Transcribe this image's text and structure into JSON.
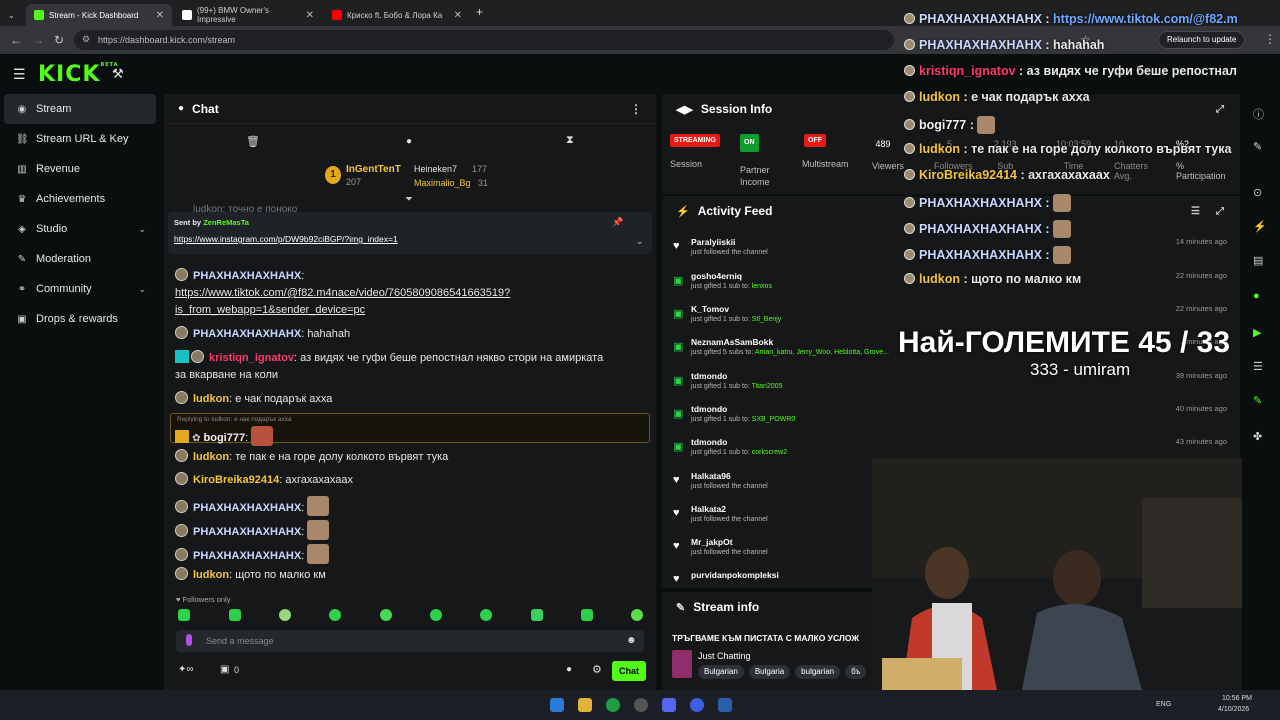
{
  "browser": {
    "tabs": [
      {
        "title": "Stream - Kick Dashboard",
        "active": true
      },
      {
        "title": "(99+) BMW Owner's Impressive",
        "active": false
      },
      {
        "title": "Криско ft. Бобо & Лора Ка",
        "active": false
      }
    ],
    "new_tab": "+",
    "url": "https://dashboard.kick.com/stream",
    "relaunch_label": "Relaunch to update"
  },
  "kick": {
    "logo": "KICK",
    "logo_beta": "BETA"
  },
  "sidebar": {
    "items": [
      {
        "label": "Stream",
        "icon": "stream-icon"
      },
      {
        "label": "Stream URL & Key",
        "icon": "link-icon"
      },
      {
        "label": "Revenue",
        "icon": "revenue-icon"
      },
      {
        "label": "Achievements",
        "icon": "trophy-icon"
      },
      {
        "label": "Studio",
        "icon": "studio-icon"
      },
      {
        "label": "Moderation",
        "icon": "wrench-icon"
      },
      {
        "label": "Community",
        "icon": "community-icon"
      },
      {
        "label": "Drops & rewards",
        "icon": "gift-icon"
      }
    ]
  },
  "chat": {
    "title": "Chat",
    "leaderboard": {
      "rank": "1",
      "first_name": "InGentTenT",
      "first_count": "207",
      "second_name": "Heineken7",
      "second_count": "177",
      "third_name": "Maximalio_Bg",
      "third_count": "31"
    },
    "behind_text": "ludkon: точно е поноко",
    "pinned": {
      "sent_by_label": "Sent by",
      "sender": "ZenReMasTa",
      "link": "https://www.instagram.com/p/DW9b92ciBGP/?img_index=1"
    },
    "messages": [
      {
        "user": "РНАХНАХНАХНАНХ",
        "text": "",
        "link": "https://www.tiktok.com/@f82.m4nace/video/7605809086541663519?",
        "link2": "is_from_webapp=1&sender_device=pc",
        "color": "#c9d8ff"
      },
      {
        "user": "РНАХНАХНАХНАНХ",
        "text": "hahahah",
        "color": "#c9d8ff"
      },
      {
        "user": "kristiqn_ignatov",
        "text": "аз видях че гуфи беше репостнал някво стори на амирката",
        "text2": "за вкарване на коли",
        "color": "#ff3b6b"
      },
      {
        "user": "ludkon",
        "text": "е чак подарък ахха",
        "color": "#f5c542"
      },
      {
        "reply": "Replying to ludkon: е чак подарък ахха",
        "user": "bogi777",
        "text": "",
        "color": "#f0f0f0"
      },
      {
        "user": "ludkon",
        "text": "те пак е на горе долу колкото вървят тука",
        "color": "#f5c542"
      },
      {
        "user": "KiroBreika92414",
        "text": "ахгахахахаах",
        "color": "#f5c542"
      },
      {
        "user": "РНАХНАХНАХНАНХ",
        "text": "",
        "color": "#c9d8ff"
      },
      {
        "user": "РНАХНАХНАХНАНХ",
        "text": "",
        "color": "#c9d8ff"
      },
      {
        "user": "РНАХНАХНАХНАНХ",
        "text": "",
        "color": "#c9d8ff"
      },
      {
        "user": "ludkon",
        "text": "щото по малко км",
        "color": "#f5c542"
      }
    ],
    "followers_only": "Followers only",
    "input_placeholder": "Send a message",
    "footer_count": "0",
    "send_label": "Chat"
  },
  "session": {
    "title": "Session Info",
    "stats": [
      {
        "value": "STREAMING",
        "label": "Session",
        "badge_color": "#e91916"
      },
      {
        "value": "ON",
        "label": "Partner Income",
        "badge_color": "#0f9d2e"
      },
      {
        "value": "OFF",
        "label": "Multistream",
        "badge_color": "#e91916"
      },
      {
        "value": "489",
        "label": "Viewers"
      },
      {
        "value": "5...",
        "label": "Followers"
      },
      {
        "value": "2,193",
        "label": "Sub"
      },
      {
        "value": "10:03:59",
        "label": "Time"
      },
      {
        "value": "10",
        "label": "Chatters Avg."
      },
      {
        "value": "%2",
        "label": "% Participation"
      }
    ]
  },
  "activity": {
    "title": "Activity Feed",
    "items": [
      {
        "name": "Paralyiiskii",
        "desc": "just followed the channel",
        "time": "14 minutes ago",
        "type": "follow"
      },
      {
        "name": "gosho4erniq",
        "desc": "just gifted 1 sub to:",
        "gift": "lenxos",
        "time": "22 minutes ago",
        "type": "gift"
      },
      {
        "name": "K_Tomov",
        "desc": "just gifted 1 sub to:",
        "gift": "Stl_Benjy",
        "time": "22 minutes ago",
        "type": "gift"
      },
      {
        "name": "NeznamAsSamBokk",
        "desc": "just gifted 5 subs to:",
        "gift": "Aman_katru, Jerry_Woo, Heblotta, Grove...",
        "time": "...minutes ago",
        "type": "gift"
      },
      {
        "name": "tdmondo",
        "desc": "just gifted 1 sub to:",
        "gift": "Titan2005",
        "time": "39 minutes ago",
        "type": "gift"
      },
      {
        "name": "tdmondo",
        "desc": "just gifted 1 sub to:",
        "gift": "SXB_POWR0",
        "time": "40 minutes ago",
        "type": "gift"
      },
      {
        "name": "tdmondo",
        "desc": "just gifted 1 sub to:",
        "gift": "corkscrew2",
        "time": "43 minutes ago",
        "type": "gift"
      },
      {
        "name": "Halkata96",
        "desc": "just followed the channel",
        "time": "",
        "type": "follow"
      },
      {
        "name": "Halkata2",
        "desc": "just followed the channel",
        "time": "",
        "type": "follow"
      },
      {
        "name": "Mr_jakpOt",
        "desc": "just followed the channel",
        "time": "",
        "type": "follow"
      },
      {
        "name": "purvidanpokompleksi",
        "desc": "",
        "time": "",
        "type": "follow"
      }
    ]
  },
  "stream_info": {
    "title": "Stream info",
    "stream_title": "ТРЪГВАМЕ КЪМ ПИСТАТА С МАЛКО УСЛОЖ",
    "category": "Just Chatting",
    "tags": [
      "Bulgarian",
      "Bulgaria",
      "bulgarian",
      "бъ"
    ]
  },
  "overlay": {
    "lines": [
      {
        "user": "РНАХНАХНАХНАНХ",
        "text": "https://www.tiktok.com/@f82.m",
        "color": "#c9d8ff",
        "text_color": "#6fa8ff"
      },
      {
        "user": "РНАХНАХНАХНАНХ",
        "text": "hahahah",
        "color": "#c9d8ff",
        "text_color": "#e9e9e9"
      },
      {
        "user": "kristiqn_ignatov",
        "text": "аз видях че гуфи беше репостнал",
        "color": "#ff3b6b",
        "text_color": "#e9e9e9"
      },
      {
        "user": "ludkon",
        "text": "е чак подарък ахха",
        "color": "#f5c542",
        "text_color": "#e9e9e9"
      },
      {
        "user": "bogi777",
        "text": "",
        "color": "#f0f0f0",
        "text_color": "#e9e9e9"
      },
      {
        "user": "ludkon",
        "text": "те пак е на горе долу колкото вървят тука",
        "color": "#f5c542",
        "text_color": "#e9e9e9"
      },
      {
        "user": "KiroBreika92414",
        "text": "ахгахахахаах",
        "color": "#f5c542",
        "text_color": "#e9e9e9"
      },
      {
        "user": "РНАХНАХНАХНАНХ",
        "text": "",
        "color": "#c9d8ff",
        "text_color": "#e9e9e9"
      },
      {
        "user": "РНАХНАХНАХНАНХ",
        "text": "",
        "color": "#c9d8ff",
        "text_color": "#e9e9e9"
      },
      {
        "user": "РНАХНАХНАХНАНХ",
        "text": "",
        "color": "#c9d8ff",
        "text_color": "#e9e9e9"
      },
      {
        "user": "ludkon",
        "text": "щото по малко км",
        "color": "#f5c542",
        "text_color": "#e9e9e9"
      }
    ],
    "goal_title": "Най-ГОЛЕМИТЕ 45 / 33",
    "goal_sub": "333 - umiram"
  },
  "taskbar": {
    "lang": "ENG",
    "time": "10:56 PM",
    "date": "4/10/2026"
  },
  "colors": {
    "accent": "#53fc18",
    "background": "#0b0e0f",
    "panel": "#151719"
  }
}
